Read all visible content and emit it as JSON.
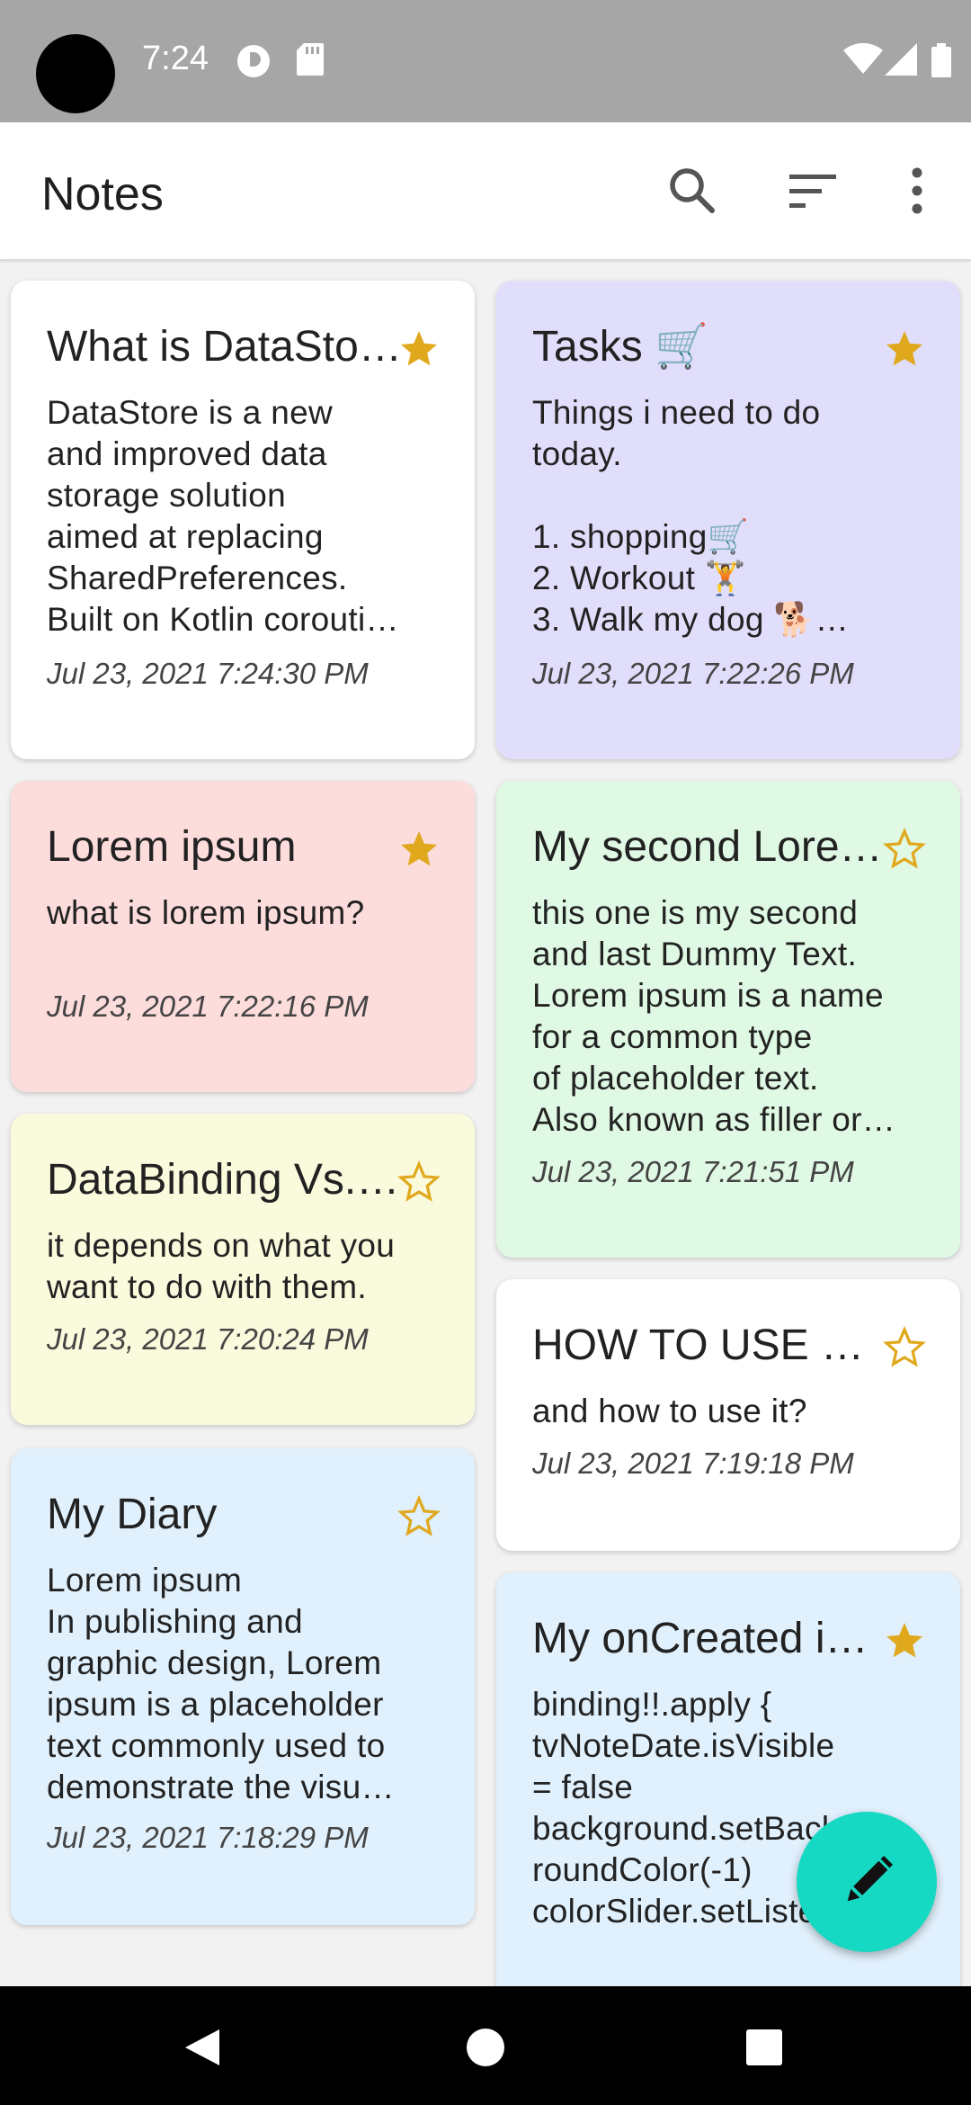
{
  "status_bar": {
    "time": "7:24"
  },
  "app_bar": {
    "title": "Notes",
    "icons": [
      "search-icon",
      "sort-icon",
      "more-vert-icon"
    ]
  },
  "notes": [
    {
      "title": "What is DataStore?",
      "body": "DataStore is a new\nand improved data\nstorage solution\naimed at replacing\nSharedPreferences.\nBuilt on Kotlin corouti…",
      "date": "Jul 23, 2021 7:24:30 PM",
      "starred": true,
      "color": "#ffffff"
    },
    {
      "title": "Tasks 🛒",
      "body": "Things i need  to do\ntoday.\n\n1. shopping🛒\n2. Workout 🏋\n3. Walk my dog 🐕…",
      "date": "Jul 23, 2021 7:22:26 PM",
      "starred": true,
      "color": "#e0defa"
    },
    {
      "title": "Lorem ipsum",
      "body": "what is lorem ipsum?",
      "date": "Jul 23, 2021 7:22:16 PM",
      "starred": true,
      "color": "#fddcdc"
    },
    {
      "title": "My second Lorem ipsum",
      "body": "this one is my second\nand last Dummy Text.\nLorem ipsum is a name\nfor a common type\nof placeholder text.\nAlso known as filler or…",
      "date": "Jul 23, 2021 7:21:51 PM",
      "starred": false,
      "color": "#e0f9e4"
    },
    {
      "title": "DataBinding Vs. ViewBinding",
      "body": "it depends on what you\nwant to do with them.",
      "date": "Jul 23, 2021 7:20:24 PM",
      "starred": false,
      "color": "#fafadd"
    },
    {
      "title": "HOW TO USE DataStore",
      "body": "and how to use it?",
      "date": "Jul 23, 2021 7:19:18 PM",
      "starred": false,
      "color": "#ffffff"
    },
    {
      "title": "My Diary",
      "body": "Lorem ipsum\nIn publishing and\ngraphic design, Lorem\nipsum is a placeholder\ntext commonly used to\ndemonstrate the visu…",
      "date": "Jul 23, 2021 7:18:29 PM",
      "starred": false,
      "color": "#e0f0fc"
    },
    {
      "title": "My onCreated is here",
      "body": " binding!!.apply {\n   tvNoteDate.isVisible\n= false\n   background.setBackg\nroundColor(-1)\n   colorSlider.setListe…",
      "date": "",
      "starred": true,
      "color": "#e0f0fc"
    }
  ],
  "colors": {
    "star": "#e0a81c",
    "fab": "#16d9c3"
  }
}
